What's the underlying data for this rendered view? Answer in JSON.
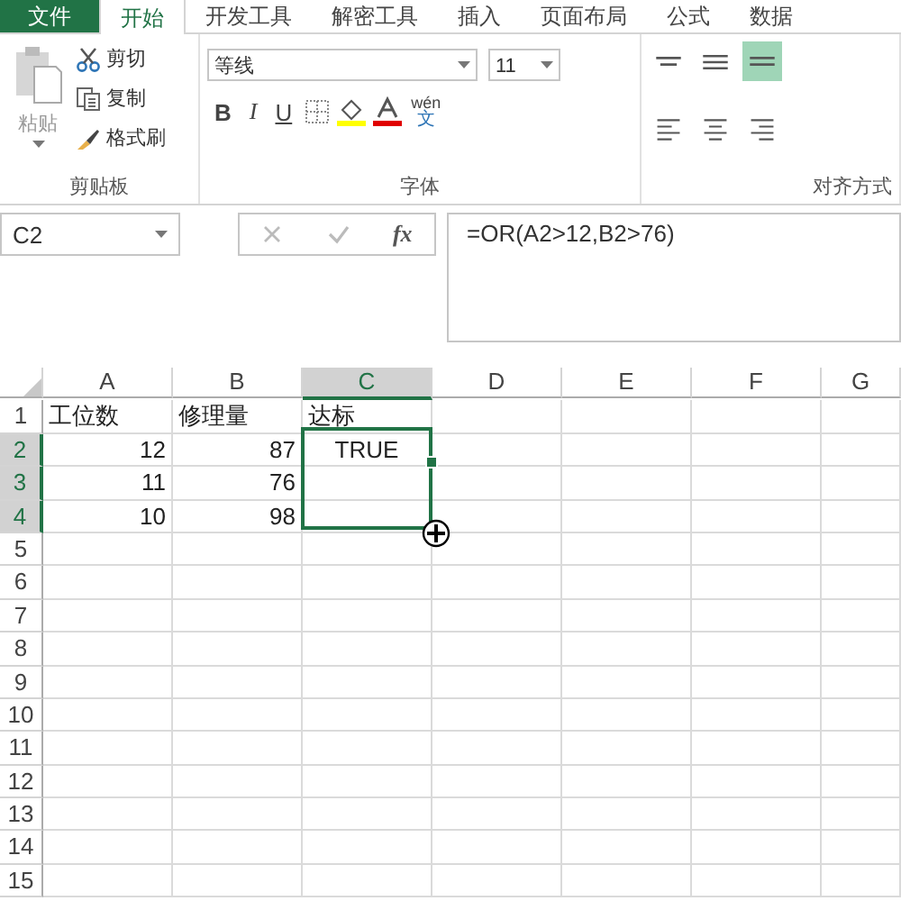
{
  "tabs": [
    {
      "label": "文件",
      "kind": "file",
      "selected": false
    },
    {
      "label": "开始",
      "kind": "tab",
      "selected": true
    },
    {
      "label": "开发工具",
      "kind": "tab",
      "selected": false
    },
    {
      "label": "解密工具",
      "kind": "tab",
      "selected": false
    },
    {
      "label": "插入",
      "kind": "tab",
      "selected": false
    },
    {
      "label": "页面布局",
      "kind": "tab",
      "selected": false
    },
    {
      "label": "公式",
      "kind": "tab",
      "selected": false
    },
    {
      "label": "数据",
      "kind": "tab",
      "selected": false
    }
  ],
  "clipboard": {
    "label": "剪贴板",
    "paste": "粘贴",
    "items": [
      {
        "kind": "cut",
        "label": "剪切"
      },
      {
        "kind": "copy",
        "label": "复制"
      },
      {
        "kind": "format-painter",
        "label": "格式刷"
      }
    ]
  },
  "font": {
    "label": "字体",
    "font_name": "等线",
    "font_size": "11",
    "bold": "B",
    "italic": "I",
    "underline": "U",
    "phonetic": "wén",
    "phonetic_char": "文"
  },
  "alignment": {
    "label": "对齐方式",
    "buttons": [
      {
        "kind": "top",
        "selected": false
      },
      {
        "kind": "middle",
        "selected": false
      },
      {
        "kind": "bottom",
        "selected": true
      },
      {
        "kind": "left",
        "selected": false
      },
      {
        "kind": "center",
        "selected": false
      },
      {
        "kind": "right",
        "selected": false
      }
    ]
  },
  "formula_bar": {
    "name_box": "C2",
    "fx": "fx",
    "formula": "=OR(A2>12,B2>76)"
  },
  "columns": [
    {
      "label": "A",
      "selected": false
    },
    {
      "label": "B",
      "selected": false
    },
    {
      "label": "C",
      "selected": true
    },
    {
      "label": "D",
      "selected": false
    },
    {
      "label": "E",
      "selected": false
    },
    {
      "label": "F",
      "selected": false
    },
    {
      "label": "G",
      "selected": false
    }
  ],
  "rows": [
    {
      "label": "1",
      "selected": false,
      "cells": [
        {
          "text": "工位数",
          "kind": "text"
        },
        {
          "text": "修理量",
          "kind": "text"
        },
        {
          "text": "达标",
          "kind": "text"
        }
      ]
    },
    {
      "label": "2",
      "selected": true,
      "cells": [
        {
          "text": "12",
          "kind": "number"
        },
        {
          "text": "87",
          "kind": "number"
        },
        {
          "text": "TRUE",
          "kind": "boolean"
        }
      ]
    },
    {
      "label": "3",
      "selected": true,
      "cells": [
        {
          "text": "11",
          "kind": "number"
        },
        {
          "text": "76",
          "kind": "number"
        }
      ]
    },
    {
      "label": "4",
      "selected": true,
      "cells": [
        {
          "text": "10",
          "kind": "number"
        },
        {
          "text": "98",
          "kind": "number"
        }
      ]
    },
    {
      "label": "5",
      "selected": false,
      "cells": []
    },
    {
      "label": "6",
      "selected": false,
      "cells": []
    },
    {
      "label": "7",
      "selected": false,
      "cells": []
    },
    {
      "label": "8",
      "selected": false,
      "cells": []
    },
    {
      "label": "9",
      "selected": false,
      "cells": []
    },
    {
      "label": "10",
      "selected": false,
      "cells": []
    },
    {
      "label": "11",
      "selected": false,
      "cells": []
    },
    {
      "label": "12",
      "selected": false,
      "cells": []
    },
    {
      "label": "13",
      "selected": false,
      "cells": []
    },
    {
      "label": "14",
      "selected": false,
      "cells": []
    },
    {
      "label": "15",
      "selected": false,
      "cells": []
    }
  ]
}
